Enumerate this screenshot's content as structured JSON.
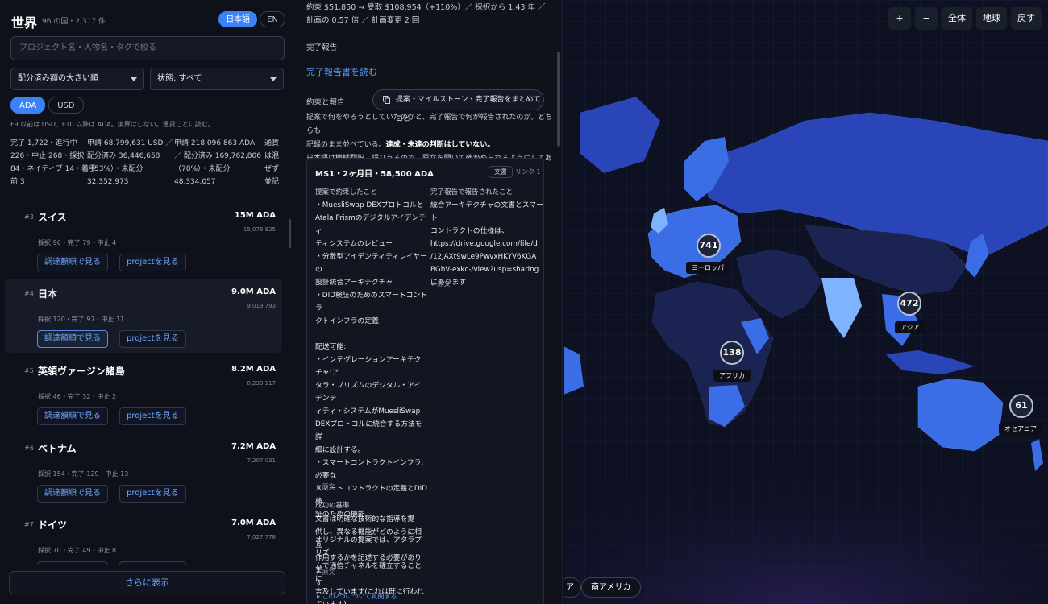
{
  "left": {
    "title": "世界",
    "subtitle": "96 の国・2,317 件",
    "lang_ja": "日本語",
    "lang_en": "EN",
    "search_placeholder": "プロジェクト名・人物名・タグで絞る",
    "sort_select": "配分済み額の大きい順",
    "status_select": "状態: すべて",
    "cur_ada": "ADA",
    "cur_usd": "USD",
    "note": "F9 以前は USD、F10 以降は ADA。換算はしない。通貨ごとに読む。",
    "stats": {
      "c1": [
        "完了 1,722・進行中",
        "226・中止 268・採択",
        "84・ネイティブ 14・着手",
        "前 3"
      ],
      "c2": [
        "申請 68,799,631 USD ／",
        "配分済み 36,446,658",
        "（53%）・未配分",
        "32,352,973"
      ],
      "c3": [
        "申請 218,096,863 ADA",
        "／ 配分済み 169,762,806",
        "（78%）・未配分",
        "48,334,057"
      ],
      "c4": [
        "通貨",
        "は混",
        "ぜず",
        "並記"
      ]
    },
    "items": [
      {
        "rank": "#3",
        "name": "スイス",
        "amount": "15M ADA",
        "amount_exact": "15,078,825",
        "meta": "採択 96・完了 79・中止 4"
      },
      {
        "rank": "#4",
        "name": "日本",
        "amount": "9.0M ADA",
        "amount_exact": "9,019,793",
        "meta": "採択 120・完了 97・中止 11"
      },
      {
        "rank": "#5",
        "name": "英領ヴァージン諸島",
        "amount": "8.2M ADA",
        "amount_exact": "8,239,117",
        "meta": "採択 46・完了 32・中止 2"
      },
      {
        "rank": "#6",
        "name": "ベトナム",
        "amount": "7.2M ADA",
        "amount_exact": "7,207,031",
        "meta": "採択 154・完了 129・中止 13"
      },
      {
        "rank": "#7",
        "name": "ドイツ",
        "amount": "7.0M ADA",
        "amount_exact": "7,027,778",
        "meta": "採択 70・完了 49・中止 8"
      }
    ],
    "btn_procure": "調達額順で見る",
    "btn_project": "projectを見る",
    "more": "さらに表示"
  },
  "mid": {
    "top_line1": "約束 $51,850 → 受取 $108,954（+110%）／ 採択から 1.43 年 ／",
    "top_line2": "計画の 0.57 倍 ／ 計画変更 2 回",
    "completion_label": "完了報告",
    "completion_link": "完了報告書を読む",
    "promise_label": "約束と報告",
    "copy_btn": "提案・マイルストーン・完了報告をまとめてコピー",
    "para1": "提案で何をやろうとしていたのかと、完了報告で何が報告されたのか。どちらも",
    "para2a": "記録のまま並べている。",
    "para2b": "達成・未達の判断はしていない。",
    "para3": "日本語は機械翻訳。誤りうるので、原文を開いて確かめられるようにしてある。",
    "card": {
      "heading": "MS1・2ヶ月目・58,500 ADA",
      "tag": "文書",
      "link": "リンク 1",
      "left_head": "提案で約束したこと",
      "right_head": "完了報告で報告されたこと",
      "left_text": "・MuesliSwap DEXプロトコルと\nAtala Prismのデジタルアイデンティ\nティシステムのレビュー\n・分散型アイデンティティレイヤーの\n設計統合アーキテクチャ\n・DID検証のためのスマートコントラ\nクトインフラの定義\n\n配送可能:\n・インテグレーションアーキテクチャ:ア\nタラ・プリズムのデジタル・アイデンテ\nィティ・システムがMuesliSwap\nDEXプロトコルに統合する方法を詳\n細に設計する。\n・スマートコントラクトインフラ:必要な\nスマートコントラクトの定義とDID検\n証のための機能。\n\nオリジナルの提案では、アタラプリズ\nムで通信チャネルを確立することに\n言及しています(これは既に行われ\nています)",
      "right_text": "統合アーキテクチャの文書とスマート\nコントラクトの仕様は、\nhttps://drive.google.com/file/d\n/12JAXt9wLe9PwvxHKYV6KGA\nBGhV-exkc-/view?usp=sharing\nにあります",
      "source": "原文",
      "criteria_label": "成功の基準",
      "criteria_text": "文書は明確な技術的な指導を提\n供し、異なる機能がどのように相互\n作用するかを記述する必要がありま\nす",
      "ask": "この2つについて質問する"
    }
  },
  "map": {
    "zoom_in": "+",
    "zoom_out": "−",
    "btn_all": "全体",
    "btn_globe": "地球",
    "btn_back": "戻す",
    "clusters": [
      {
        "count": "741",
        "label": "ヨーロッパ"
      },
      {
        "count": "472",
        "label": "アジア"
      },
      {
        "count": "138",
        "label": "アフリカ"
      },
      {
        "count": "61",
        "label": "オセアニア"
      }
    ],
    "region_partial": "ア",
    "region_sa": "南アメリカ",
    "colors": {
      "land_dark": "#1b2352",
      "land_mid": "#2a45b8",
      "land_bright": "#3b6ee6",
      "land_light": "#7fb3ff"
    }
  }
}
